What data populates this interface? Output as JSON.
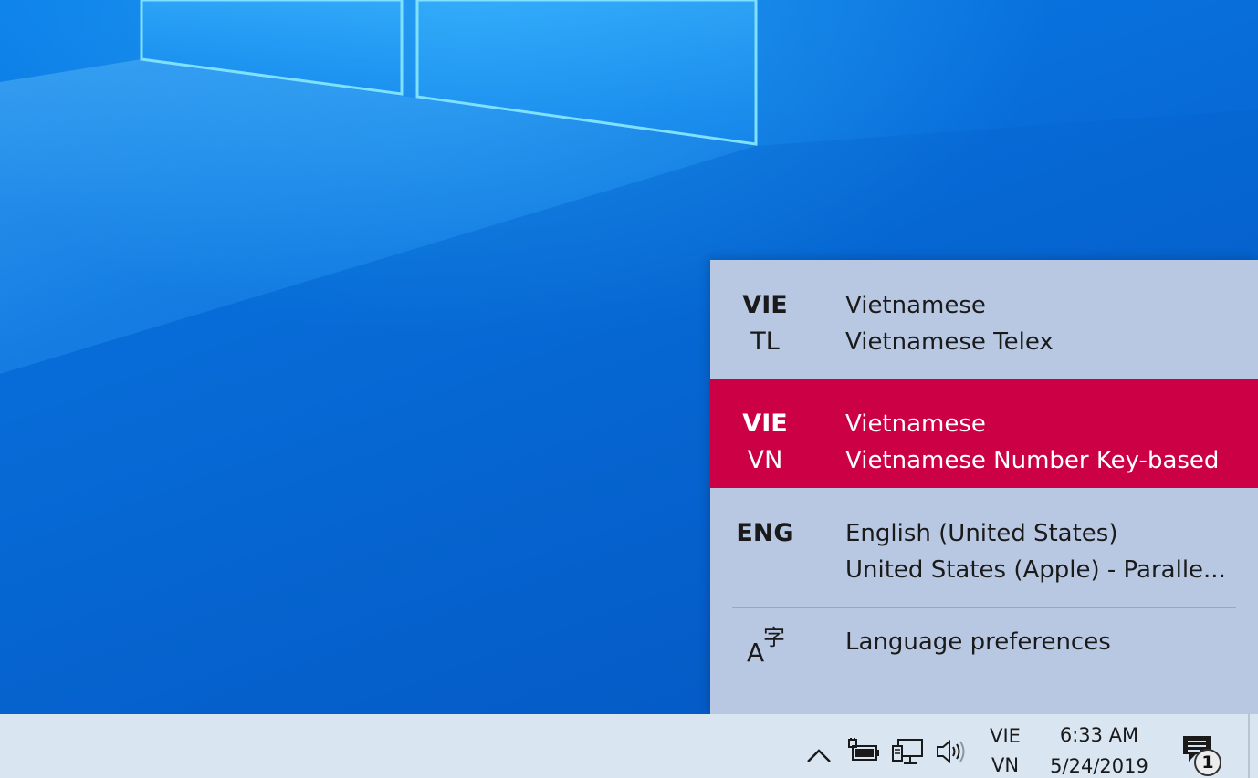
{
  "input_switcher": {
    "items": [
      {
        "code": "VIE",
        "sub": "TL",
        "language": "Vietnamese",
        "layout": "Vietnamese Telex",
        "selected": false
      },
      {
        "code": "VIE",
        "sub": "VN",
        "language": "Vietnamese",
        "layout": "Vietnamese Number Key-based",
        "selected": true
      },
      {
        "code": "ENG",
        "sub": "",
        "language": "English (United States)",
        "layout": "United States (Apple) - Paralle...",
        "selected": false
      }
    ],
    "preferences": {
      "icon": "language-preferences-icon",
      "label": "Language preferences"
    },
    "colors": {
      "background": "#b9c8e2",
      "selected_background": "#cc0044",
      "selected_text": "#ffffff"
    }
  },
  "taskbar": {
    "tray_icons": [
      "chevron-up-icon",
      "battery-plug-icon",
      "network-icon",
      "volume-icon"
    ],
    "ime_indicator": {
      "code": "VIE",
      "sub": "VN"
    },
    "clock": {
      "time": "6:33 AM",
      "date": "5/24/2019"
    },
    "notifications": {
      "icon": "action-center-icon",
      "count": "1"
    },
    "background": "#dae5f2"
  },
  "desktop": {
    "wallpaper": "windows-10-default-wallpaper"
  }
}
